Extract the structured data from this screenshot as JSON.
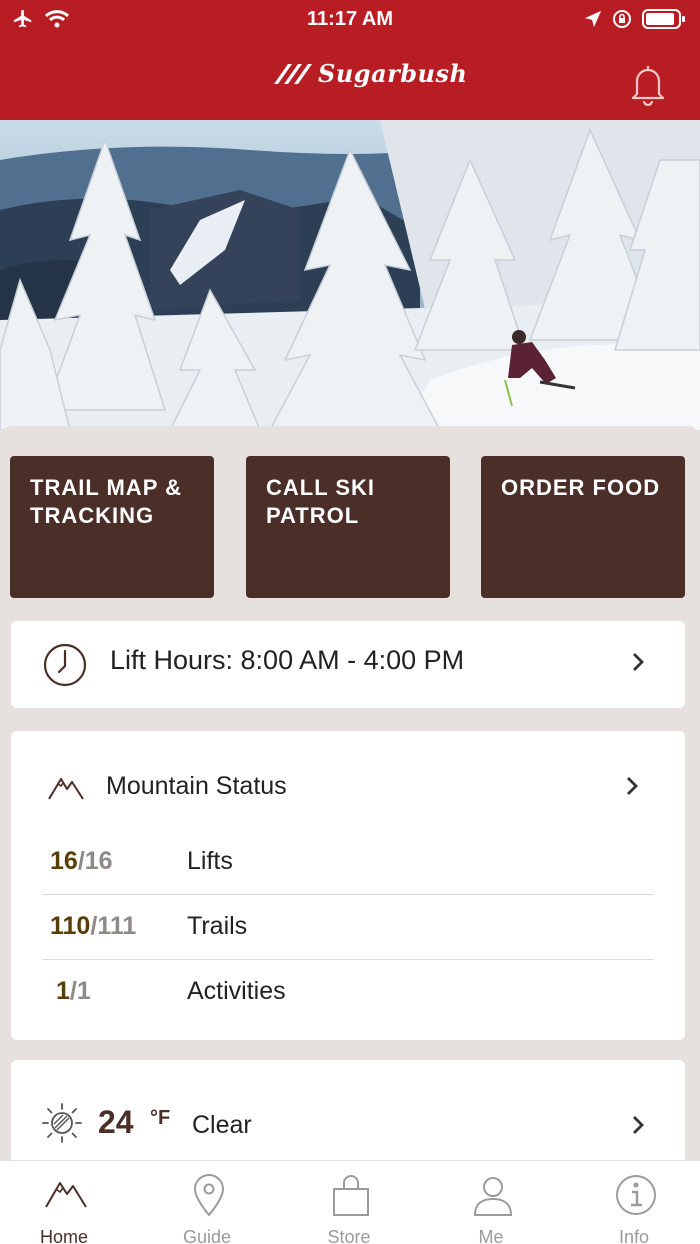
{
  "status_bar": {
    "time": "11:17 AM"
  },
  "header": {
    "logo_text": "Sugarbush"
  },
  "quick_actions": [
    {
      "label": "TRAIL MAP & TRACKING"
    },
    {
      "label": "CALL SKI PATROL"
    },
    {
      "label": "ORDER FOOD"
    }
  ],
  "lift_hours": {
    "label": "Lift Hours: 8:00 AM - 4:00 PM"
  },
  "mountain_status": {
    "title": "Mountain Status",
    "rows": [
      {
        "open": "16",
        "total": "/16",
        "label": "Lifts"
      },
      {
        "open": "110",
        "total": "/111",
        "label": "Trails"
      },
      {
        "open": "1",
        "total": "/1",
        "label": "Activities"
      }
    ]
  },
  "weather": {
    "temp": "24",
    "unit": "°F",
    "condition": "Clear"
  },
  "tabs": [
    {
      "label": "Home",
      "icon": "mountain-icon",
      "active": true
    },
    {
      "label": "Guide",
      "icon": "map-pin-icon"
    },
    {
      "label": "Store",
      "icon": "shopping-bag-icon"
    },
    {
      "label": "Me",
      "icon": "person-icon"
    },
    {
      "label": "Info",
      "icon": "info-icon"
    }
  ],
  "colors": {
    "brand_red": "#b71d22",
    "brown": "#4a2e27",
    "gold": "#5a3e08",
    "background": "#e6e1de"
  }
}
